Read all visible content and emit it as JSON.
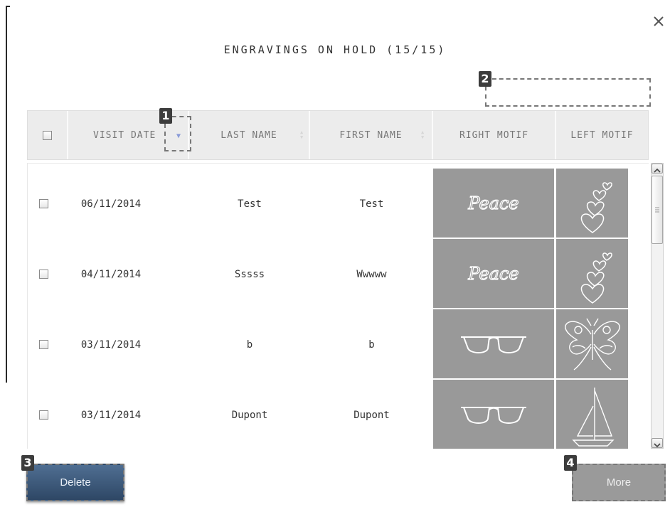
{
  "dialog": {
    "title": "ENGRAVINGS ON HOLD (15/15)",
    "close_icon": "close-icon"
  },
  "search": {
    "value": "",
    "placeholder": ""
  },
  "callouts": [
    "1",
    "2",
    "3",
    "4"
  ],
  "table": {
    "columns": [
      {
        "label": "",
        "type": "select-all-checkbox"
      },
      {
        "label": "VISIT DATE",
        "sort": "descending"
      },
      {
        "label": "LAST NAME",
        "sort": "none"
      },
      {
        "label": "FIRST NAME",
        "sort": "none"
      },
      {
        "label": "RIGHT MOTIF"
      },
      {
        "label": "LEFT MOTIF"
      }
    ],
    "rows": [
      {
        "visit_date": "06/11/2014",
        "last_name": "Test",
        "first_name": "Test",
        "right_motif": "peace-text-icon",
        "left_motif": "hearts-icon"
      },
      {
        "visit_date": "04/11/2014",
        "last_name": "Sssss",
        "first_name": "Wwwww",
        "right_motif": "peace-text-icon",
        "left_motif": "hearts-icon"
      },
      {
        "visit_date": "03/11/2014",
        "last_name": "b",
        "first_name": "b",
        "right_motif": "glasses-icon",
        "left_motif": "butterfly-icon"
      },
      {
        "visit_date": "03/11/2014",
        "last_name": "Dupont",
        "first_name": "Dupont",
        "right_motif": "glasses-icon",
        "left_motif": "sailboat-icon"
      }
    ],
    "peace_text": "Peace"
  },
  "buttons": {
    "delete_label": "Delete",
    "more_label": "More"
  },
  "colors": {
    "delete_button": "#3e5a7c",
    "more_button": "#9a9a9a",
    "motif_bg": "#999999",
    "header_bg": "#ececec",
    "sort_active": "#8a9bd8"
  }
}
